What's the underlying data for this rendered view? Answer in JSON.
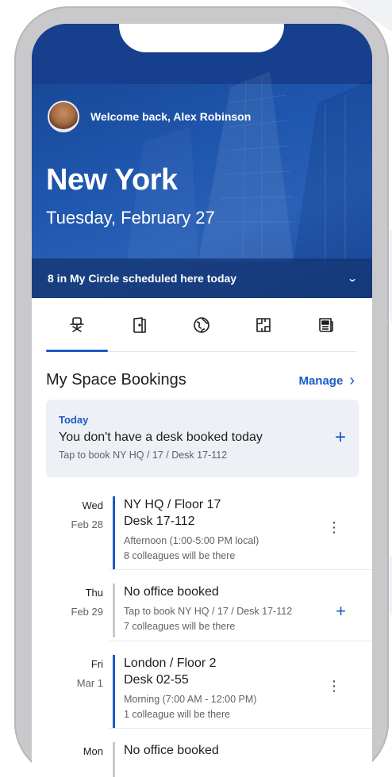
{
  "header": {
    "welcome": "Welcome back, Alex Robinson",
    "city": "New York",
    "date": "Tuesday, February 27",
    "circle_banner": "8 in My Circle scheduled here today"
  },
  "tabs": [
    {
      "icon": "desk-chair-icon",
      "selected": true
    },
    {
      "icon": "room-door-icon",
      "selected": false
    },
    {
      "icon": "globe-icon",
      "selected": false
    },
    {
      "icon": "floor-map-icon",
      "selected": false
    },
    {
      "icon": "news-icon",
      "selected": false
    }
  ],
  "bookings_section": {
    "title": "My Space Bookings",
    "manage_label": "Manage",
    "today": {
      "label": "Today",
      "title": "You don't have a desk booked today",
      "subtitle": "Tap to book NY HQ / 17 / Desk 17-112"
    },
    "items": [
      {
        "dow": "Wed",
        "day": "Feb 28",
        "title1": "NY HQ / Floor 17",
        "title2": "Desk 17-112",
        "line1": "Afternoon (1:00-5:00 PM local)",
        "line2": "8 colleagues will be there"
      },
      {
        "dow": "Thu",
        "day": "Feb 29",
        "title1": "No office booked",
        "line1": "Tap to book NY HQ / 17 / Desk 17-112",
        "line2": "7 colleagues will be there"
      },
      {
        "dow": "Fri",
        "day": "Mar 1",
        "title1": "London / Floor 2",
        "title2": "Desk 02-55",
        "line1": "Morning (7:00 AM - 12:00 PM)",
        "line2": "1 colleague will be there"
      },
      {
        "dow": "Mon",
        "title1": "No office booked"
      }
    ]
  },
  "colors": {
    "accent": "#1a5bc7",
    "hero": "#1f56ad",
    "card": "#edf0f5"
  }
}
